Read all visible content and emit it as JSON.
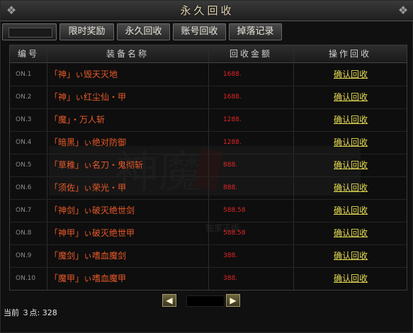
{
  "window": {
    "title": "永久回收"
  },
  "tabs": [
    {
      "label": "限时奖励"
    },
    {
      "label": "永久回收"
    },
    {
      "label": "账号回收"
    },
    {
      "label": "掉落记录"
    }
  ],
  "table": {
    "headers": [
      "编号",
      "装备名称",
      "回收金额",
      "操作回收"
    ],
    "rows": [
      {
        "no": "ON.1",
        "name": "「神」ぃ毁天灭地",
        "amount": "1688.",
        "action": "确认回收"
      },
      {
        "no": "ON.2",
        "name": "「神」ぃ红尘仙・甲",
        "amount": "1688.",
        "action": "确认回收"
      },
      {
        "no": "ON.3",
        "name": "「魔」・万人斩",
        "amount": "1288.",
        "action": "确认回收"
      },
      {
        "no": "ON.4",
        "name": "「暗黑」ぃ绝对防御",
        "amount": "1288.",
        "action": "确认回收"
      },
      {
        "no": "ON.5",
        "name": "「草稚」ぃ名刀・鬼彻斩",
        "amount": "888.",
        "action": "确认回收"
      },
      {
        "no": "ON.6",
        "name": "「须佐」ぃ荣光・甲",
        "amount": "888.",
        "action": "确认回收"
      },
      {
        "no": "ON.7",
        "name": "「神剑」ぃ破灭绝世剑",
        "amount": "588.58",
        "action": "确认回收"
      },
      {
        "no": "ON.8",
        "name": "「神甲」ぃ破灭绝世甲",
        "amount": "588.58",
        "action": "确认回收"
      },
      {
        "no": "ON.9",
        "name": "「魔剑」ぃ嗜血魔剑",
        "amount": "388.",
        "action": "确认回收"
      },
      {
        "no": "ON.10",
        "name": "「魔甲」ぃ嗜血魔甲",
        "amount": "388.",
        "action": "确认回收"
      }
    ]
  },
  "watermark": {
    "line1": "神魔",
    "line2": "独家正版"
  },
  "pager": {
    "prev_icon": "chevron-left-icon",
    "next_icon": "chevron-right-icon"
  },
  "status": {
    "text": "当前 ３点: 328"
  },
  "colors": {
    "item_name": "#e85a28",
    "amount": "#e52525",
    "action": "#e6dc52",
    "title": "#e6d7b4"
  }
}
